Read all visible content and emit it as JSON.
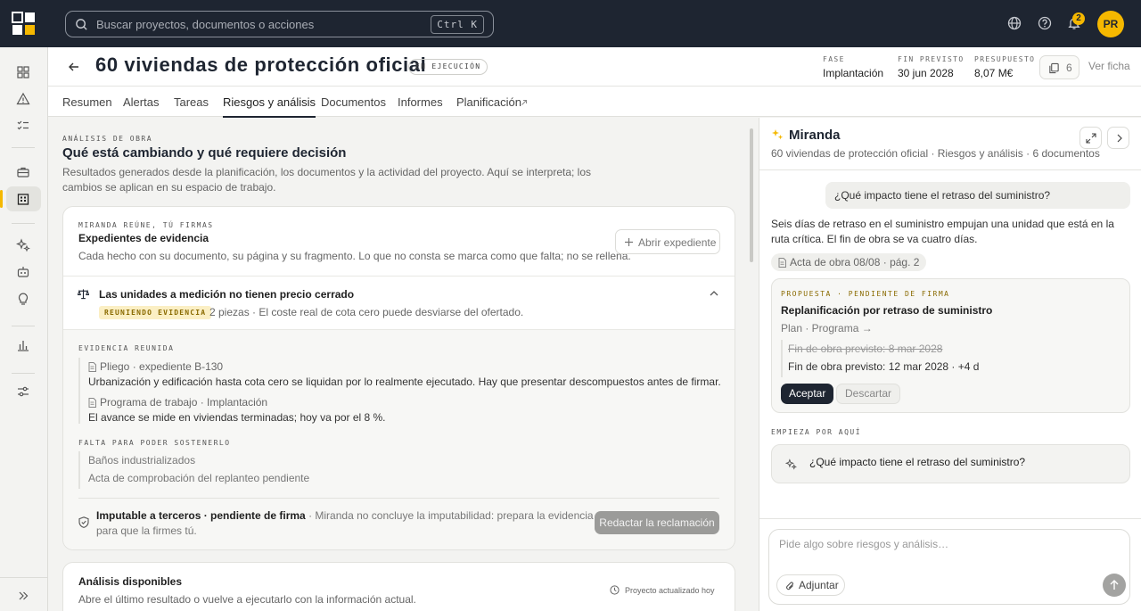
{
  "search": {
    "placeholder": "Buscar proyectos, documentos o acciones",
    "shortcut": "Ctrl K"
  },
  "topbar": {
    "notifications_count": "2",
    "avatar_initials": "PR"
  },
  "project": {
    "title": "60 viviendas de protección oficial",
    "status": "EN EJECUCIÓN",
    "meta": [
      {
        "label": "FASE",
        "value": "Implantación"
      },
      {
        "label": "FIN PREVISTO",
        "value": "30 jun 2028"
      },
      {
        "label": "PRESUPUESTO",
        "value": "8,07 M€"
      }
    ],
    "documents_count": "6",
    "ver_ficha": "Ver ficha"
  },
  "tabs": [
    "Resumen",
    "Alertas",
    "Tareas",
    "Riesgos y análisis",
    "Documentos",
    "Informes",
    "Planificación"
  ],
  "intro": {
    "eyebrow": "ANÁLISIS DE OBRA",
    "title": "Qué está cambiando y qué requiere decisión",
    "desc": "Resultados generados desde la planificación, los documentos y la actividad del proyecto. Aquí se interpreta; los cambios se aplican en su espacio de trabajo."
  },
  "evidence": {
    "eyebrow": "MIRANDA REÚNE, TÚ FIRMAS",
    "title": "Expedientes de evidencia",
    "desc": "Cada hecho con su documento, su página y su fragmento. Lo que no consta se marca como que falta; no se rellena.",
    "open_button": "Abrir expediente",
    "item": {
      "title": "Las unidades a medición no tienen precio cerrado",
      "badge": "REUNIENDO EVIDENCIA",
      "summary": "2 piezas · El coste real de cota cero puede desviarse del ofertado."
    },
    "gathered_label": "EVIDENCIA REUNIDA",
    "gathered": [
      {
        "source": "Pliego · expediente B-130",
        "text": "Urbanización y edificación hasta cota cero se liquidan por lo realmente ejecutado. Hay que presentar descompuestos antes de firmar."
      },
      {
        "source": "Programa de trabajo · Implantación",
        "text": "El avance se mide en viviendas terminadas; hoy va por el 8 %."
      }
    ],
    "missing_label": "FALTA PARA PODER SOSTENERLO",
    "missing": [
      "Baños industrializados",
      "Acta de comprobación del replanteo pendiente"
    ],
    "footer": {
      "strong": "Imputable a terceros · pendiente de firma",
      "rest": " · Miranda no concluye la imputabilidad: prepara la evidencia para que la firmes tú.",
      "button": "Redactar la reclamación"
    }
  },
  "available": {
    "title": "Análisis disponibles",
    "desc": "Abre el último resultado o vuelve a ejecutarlo con la información actual.",
    "updated": "Proyecto actualizado hoy"
  },
  "miranda": {
    "name": "Miranda",
    "context": "60 viviendas de protección oficial · Riesgos y análisis · 6 documentos",
    "user_question": "¿Qué impacto tiene el retraso del suministro?",
    "answer": "Seis días de retraso en el suministro empujan una unidad que está en la ruta crítica. El fin de obra se va cuatro días.",
    "citation": "Acta de obra 08/08 · pág. 2",
    "proposal": {
      "eyebrow": "PROPUESTA · PENDIENTE DE FIRMA",
      "title": "Replanificación por retraso de suministro",
      "link": "Plan · Programa",
      "old_value": "Fin de obra previsto: 8 mar 2028",
      "new_value": "Fin de obra previsto: 12 mar 2028 · +4 d",
      "accept": "Aceptar",
      "discard": "Descartar"
    },
    "start_label": "EMPIEZA POR AQUÍ",
    "suggestion": "¿Qué impacto tiene el retraso del suministro?",
    "input_placeholder": "Pide algo sobre riesgos y análisis…",
    "attach": "Adjuntar"
  },
  "colors": {
    "navy": "#1e2531",
    "accent": "#f5b800",
    "badge_bg": "#fbefc4",
    "badge_text": "#8a6a00"
  }
}
